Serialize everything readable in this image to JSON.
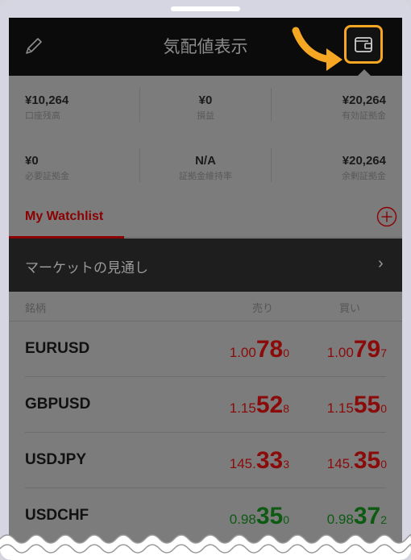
{
  "header": {
    "title": "気配値表示",
    "edit_icon": "pencil-icon",
    "wallet_icon": "wallet-icon",
    "highlight_color": "#f5a623"
  },
  "account": {
    "stats": [
      {
        "value": "¥10,264",
        "label": "口座残高"
      },
      {
        "value": "¥0",
        "label": "損益"
      },
      {
        "value": "¥20,264",
        "label": "有効証拠金"
      },
      {
        "value": "¥0",
        "label": "必要証拠金"
      },
      {
        "value": "N/A",
        "label": "証拠金維持率"
      },
      {
        "value": "¥20,264",
        "label": "余剰証拠金"
      }
    ]
  },
  "tabs": {
    "active_label": "My Watchlist",
    "add_icon": "plus-circle-icon"
  },
  "outlook": {
    "label": "マーケットの見通し",
    "chevron": "›"
  },
  "watchlist": {
    "columns": {
      "symbol": "銘柄",
      "bid": "売り",
      "ask": "買い"
    },
    "rows": [
      {
        "symbol": "EURUSD",
        "color": "#8b0a0a",
        "bid": {
          "prefix": "1.00",
          "big": "78",
          "pip": "0"
        },
        "ask": {
          "prefix": "1.00",
          "big": "79",
          "pip": "7"
        }
      },
      {
        "symbol": "GBPUSD",
        "color": "#8b0a0a",
        "bid": {
          "prefix": "1.15",
          "big": "52",
          "pip": "8"
        },
        "ask": {
          "prefix": "1.15",
          "big": "55",
          "pip": "0"
        }
      },
      {
        "symbol": "USDJPY",
        "color": "#8b0a0a",
        "bid": {
          "prefix": "145.",
          "big": "33",
          "pip": "3"
        },
        "ask": {
          "prefix": "145.",
          "big": "35",
          "pip": "0"
        }
      },
      {
        "symbol": "USDCHF",
        "color": "#0d5a12",
        "bid": {
          "prefix": "0.98",
          "big": "35",
          "pip": "0"
        },
        "ask": {
          "prefix": "0.98",
          "big": "37",
          "pip": "2"
        }
      }
    ]
  }
}
